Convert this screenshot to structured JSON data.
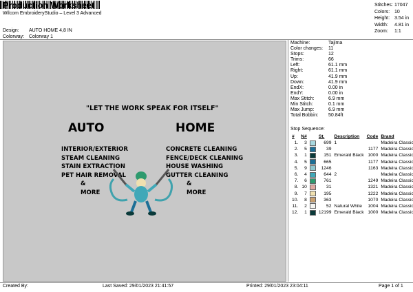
{
  "header": {
    "title": "Production Worksheet",
    "subtitle": "Wilcom EmbroideryStudio – Level 3 Advanced",
    "design_label": "Design:",
    "design_value": "AUTO HOME 4,8 IN",
    "colorway_label": "Colorway:",
    "colorway_value": "Colorway 1"
  },
  "stats": [
    {
      "k": "Stitches:",
      "v": "17047"
    },
    {
      "k": "Colors:",
      "v": "10"
    },
    {
      "k": "Height:",
      "v": "3.54 in"
    },
    {
      "k": "Width:",
      "v": "4.81 in"
    },
    {
      "k": "Zoom:",
      "v": "1:1"
    }
  ],
  "machine_info": [
    {
      "k": "Machine:",
      "v": "Tajima"
    },
    {
      "k": "Color changes:",
      "v": "11"
    },
    {
      "k": "Stops:",
      "v": "12"
    },
    {
      "k": "Trims:",
      "v": "66"
    },
    {
      "k": "Left:",
      "v": "61.1 mm"
    },
    {
      "k": "Right:",
      "v": "61.1 mm"
    },
    {
      "k": "Up:",
      "v": "41.9 mm"
    },
    {
      "k": "Down:",
      "v": "41.9 mm"
    },
    {
      "k": "EndX:",
      "v": "0.00 in"
    },
    {
      "k": "EndY:",
      "v": "0.00 in"
    },
    {
      "k": "Max Stitch:",
      "v": "6.9 mm"
    },
    {
      "k": "Min Stitch:",
      "v": "0.1 mm"
    },
    {
      "k": "Max Jump:",
      "v": "6.9 mm"
    },
    {
      "k": "Total Bobbin:",
      "v": "50.84ft"
    }
  ],
  "stop_sequence": {
    "title": "Stop Sequence:",
    "headers": [
      "#",
      "N#",
      "",
      "St.",
      "Description",
      "Code",
      "Brand"
    ],
    "rows": [
      {
        "n": "1.",
        "needle": "3",
        "color": "#a8d8e0",
        "st": "699",
        "desc": "1",
        "code": "",
        "brand": "Madeira Classic 40"
      },
      {
        "n": "2.",
        "needle": "5",
        "color": "#1d6f96",
        "st": "39",
        "desc": "",
        "code": "1177",
        "brand": "Madeira Classic 40"
      },
      {
        "n": "3.",
        "needle": "1",
        "color": "#0a3a3a",
        "st": "151",
        "desc": "Emerald Black",
        "code": "1000",
        "brand": "Madeira Classic 40"
      },
      {
        "n": "4.",
        "needle": "5",
        "color": "#1d6f96",
        "st": "665",
        "desc": "",
        "code": "1177",
        "brand": "Madeira Classic 40"
      },
      {
        "n": "5.",
        "needle": "9",
        "color": "#8ec8d0",
        "st": "1246",
        "desc": "",
        "code": "1163",
        "brand": "Madeira Classic 40"
      },
      {
        "n": "6.",
        "needle": "4",
        "color": "#40a8b8",
        "st": "644",
        "desc": "2",
        "code": "",
        "brand": "Madeira Classic 40"
      },
      {
        "n": "7.",
        "needle": "6",
        "color": "#2e9a6e",
        "st": "761",
        "desc": "",
        "code": "1249",
        "brand": "Madeira Classic 40"
      },
      {
        "n": "8.",
        "needle": "10",
        "color": "#e0a8a0",
        "st": "31",
        "desc": "",
        "code": "1321",
        "brand": "Madeira Classic 40"
      },
      {
        "n": "9.",
        "needle": "7",
        "color": "#f0e0b0",
        "st": "195",
        "desc": "",
        "code": "1222",
        "brand": "Madeira Classic 40"
      },
      {
        "n": "10.",
        "needle": "8",
        "color": "#c8a070",
        "st": "363",
        "desc": "",
        "code": "1070",
        "brand": "Madeira Classic 40"
      },
      {
        "n": "11.",
        "needle": "2",
        "color": "#f4f4f0",
        "st": "52",
        "desc": "Natural White",
        "code": "1004",
        "brand": "Madeira Classic 40"
      },
      {
        "n": "12.",
        "needle": "1",
        "color": "#0a3a3a",
        "st": "12199",
        "desc": "Emerald Black",
        "code": "1000",
        "brand": "Madeira Classic 40"
      }
    ]
  },
  "design_text": {
    "slogan": "\"LET THE WORK SPEAK FOR ITSELF\"",
    "auto_title": "AUTO",
    "home_title": "HOME",
    "auto_lines": [
      "INTERIOR/EXTERIOR",
      "STEAM CLEANING",
      "STAIN EXTRACTION",
      "PET HAIR REMOVAL",
      "&",
      "MORE"
    ],
    "home_lines": [
      "CONCRETE CLEANING",
      "FENCE/DECK CLEANING",
      "HOUSE WASHING",
      "GUTTER CLEANING",
      "&",
      "MORE"
    ]
  },
  "footer": {
    "created_by": "Created By:",
    "last_saved": "Last Saved: 29/01/2023 21:41:57",
    "printed": "Printed: 29/01/2023 23:04:11",
    "page": "Page 1 of 1"
  }
}
